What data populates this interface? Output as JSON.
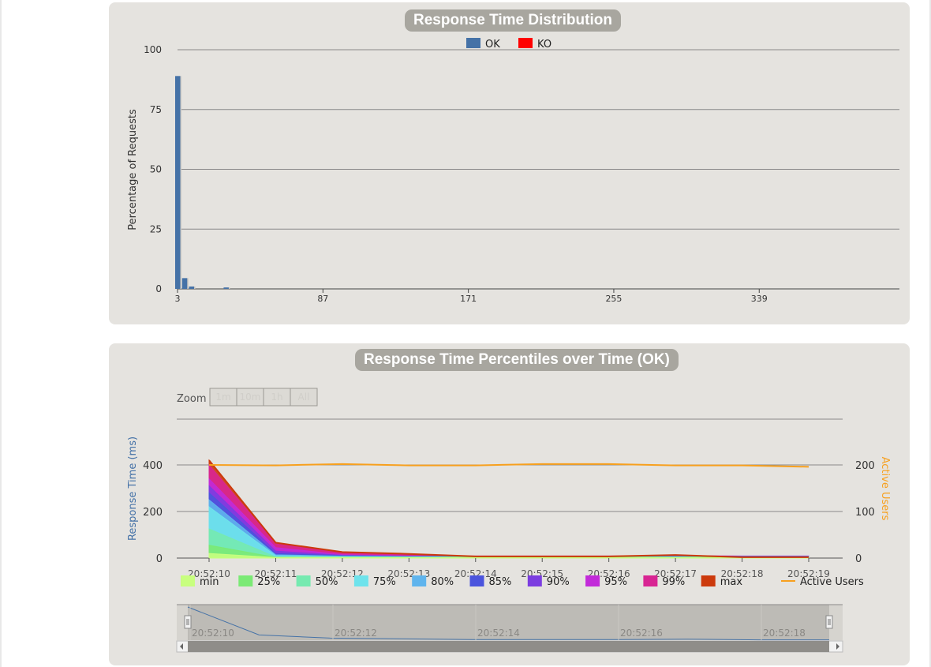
{
  "distribution": {
    "title": "Response Time Distribution",
    "colors": {
      "ok": "#4572a7",
      "ko": "#ff0000"
    }
  },
  "percentiles": {
    "title": "Response Time Percentiles over Time (OK)",
    "zoom": {
      "label": "Zoom",
      "buttons": [
        "1m",
        "10m",
        "1h",
        "All"
      ]
    },
    "navigator_ticks": [
      "20:52:10",
      "20:52:12",
      "20:52:14",
      "20:52:16",
      "20:52:18"
    ],
    "colors": {
      "min": "#c8ff7f",
      "25%": "#7bea75",
      "50%": "#76eab0",
      "75%": "#6ee3ec",
      "80%": "#5fb4ed",
      "85%": "#4b54dd",
      "90%": "#7b3de0",
      "95%": "#c22ad9",
      "99%": "#d82593",
      "max": "#cc3a0c",
      "Active Users": "#f7a01e"
    }
  },
  "chart_data": [
    {
      "type": "bar",
      "title": "Response Time Distribution",
      "xlabel": "",
      "ylabel": "Percentage of Requests",
      "ylim": [
        0,
        100
      ],
      "yticks": [
        0,
        25,
        50,
        75,
        100
      ],
      "xticks": [
        3,
        87,
        171,
        255,
        339
      ],
      "grid": true,
      "legend": "top-center",
      "x": [
        3,
        7,
        11,
        31
      ],
      "series": [
        {
          "name": "OK",
          "values": [
            89,
            4.5,
            1,
            0.6
          ]
        },
        {
          "name": "KO",
          "values": [
            0,
            0,
            0,
            0
          ]
        }
      ]
    },
    {
      "type": "area",
      "title": "Response Time Percentiles over Time (OK)",
      "ylabel": "Response Time (ms)",
      "ylabel_right": "Active Users",
      "ylim": [
        0,
        400
      ],
      "ylim_right": [
        0,
        200
      ],
      "yticks": [
        0,
        200,
        400
      ],
      "yticks_right": [
        0,
        100,
        200
      ],
      "legend": "bottom",
      "x": [
        "20:52:10",
        "20:52:11",
        "20:52:12",
        "20:52:13",
        "20:52:14",
        "20:52:15",
        "20:52:16",
        "20:52:17",
        "20:52:18",
        "20:52:19"
      ],
      "series": [
        {
          "name": "min",
          "values": [
            20,
            2,
            2,
            2,
            2,
            2,
            2,
            2,
            2,
            2
          ]
        },
        {
          "name": "25%",
          "values": [
            55,
            3,
            3,
            3,
            3,
            3,
            3,
            3,
            3,
            3
          ]
        },
        {
          "name": "50%",
          "values": [
            125,
            5,
            4,
            4,
            4,
            4,
            4,
            4,
            4,
            4
          ]
        },
        {
          "name": "75%",
          "values": [
            220,
            10,
            6,
            5,
            5,
            5,
            5,
            5,
            5,
            5
          ]
        },
        {
          "name": "80%",
          "values": [
            250,
            14,
            8,
            6,
            6,
            6,
            6,
            6,
            6,
            6
          ]
        },
        {
          "name": "85%",
          "values": [
            280,
            20,
            10,
            7,
            7,
            7,
            7,
            7,
            7,
            7
          ]
        },
        {
          "name": "90%",
          "values": [
            310,
            30,
            12,
            8,
            8,
            8,
            8,
            8,
            8,
            8
          ]
        },
        {
          "name": "95%",
          "values": [
            340,
            45,
            15,
            9,
            9,
            9,
            9,
            10,
            9,
            9
          ]
        },
        {
          "name": "99%",
          "values": [
            400,
            62,
            22,
            15,
            7,
            7,
            7,
            10,
            4,
            4
          ]
        },
        {
          "name": "max",
          "values": [
            420,
            66,
            26,
            18,
            7,
            7,
            7,
            13,
            4,
            4
          ]
        },
        {
          "name": "Active Users",
          "axis": "right",
          "values": [
            200,
            199,
            202,
            199,
            199,
            202,
            202,
            199,
            199,
            196
          ]
        }
      ]
    }
  ]
}
